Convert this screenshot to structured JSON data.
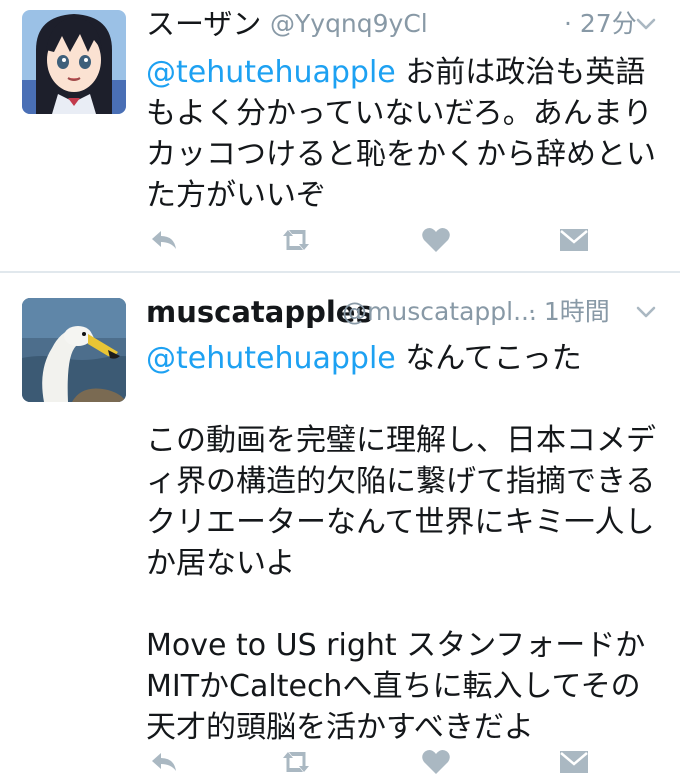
{
  "tweets": [
    {
      "display_name": "スーザン",
      "screen_name": "@Yyqnq9yCl",
      "time": "· 27分",
      "body": {
        "mention": "@tehutehuapple",
        "text": "お前は政治も英語もよく分かっていないだろ。あんまりカッコつけると恥をかくから辞めといた方がいいぞ"
      },
      "avatar_icon": "anime-girl-avatar"
    },
    {
      "display_name": "muscatapples",
      "screen_name": "@muscatappl...",
      "time": "· 1時間",
      "body": {
        "mention": "@tehutehuapple",
        "line1": "なんてこった",
        "para2": "この動画を完璧に理解し、日本コメディ界の構造的欠陥に繋げて指摘できるクリエーターなんて世界にキミ一人しか居ないよ",
        "para3": "Move to US right スタンフォードかMITかCaltechへ直ちに転入してその天才的頭脳を活かすべきだよ"
      },
      "avatar_icon": "swan-avatar"
    }
  ],
  "colors": {
    "link": "#1da1f2",
    "muted": "#8899a6",
    "icon": "#aab8c2"
  }
}
